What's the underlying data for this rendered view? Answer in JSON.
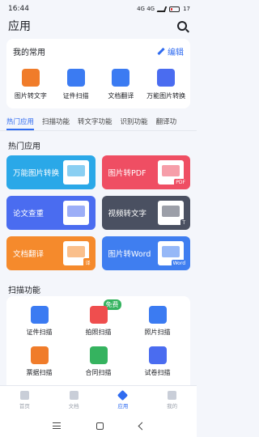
{
  "status_bar": {
    "time": "16:44",
    "network_text": "4G 4G",
    "battery": "17"
  },
  "header": {
    "title": "应用"
  },
  "favorites": {
    "title": "我的常用",
    "edit_label": "编辑",
    "items": [
      {
        "label": "图片转文字",
        "icon": "image-text-icon",
        "color": "#f07c2a"
      },
      {
        "label": "证件扫描",
        "icon": "id-scan-icon",
        "color": "#3b7bf2"
      },
      {
        "label": "文档翻译",
        "icon": "doc-translate-icon",
        "color": "#3b7bf2"
      },
      {
        "label": "万能图片转换",
        "icon": "image-convert-icon",
        "color": "#4a6cf0"
      }
    ]
  },
  "tabs": [
    "热门应用",
    "扫描功能",
    "转文字功能",
    "识别功能",
    "翻译功"
  ],
  "hot_apps": {
    "title": "热门应用",
    "tiles": [
      {
        "label": "万能图片转换",
        "color": "#2aa8e8",
        "tag": "",
        "icon": "image-convert-icon"
      },
      {
        "label": "图片转PDF",
        "color": "#ef4e63",
        "tag": "PDF",
        "icon": "pdf-icon"
      },
      {
        "label": "论文查重",
        "color": "#4a6cf0",
        "tag": "",
        "icon": "magnifier-icon"
      },
      {
        "label": "视频转文字",
        "color": "#4a5061",
        "tag": "T",
        "icon": "video-text-icon"
      },
      {
        "label": "文档翻译",
        "color": "#f58a2c",
        "tag": "译",
        "icon": "translate-icon"
      },
      {
        "label": "图片转Word",
        "color": "#3f7ef0",
        "tag": "Word",
        "icon": "word-icon"
      }
    ]
  },
  "scan": {
    "title": "扫描功能",
    "free_badge": "免费",
    "rows": [
      [
        {
          "label": "证件扫描",
          "color": "#3b7bf2",
          "icon": "id-scan-icon"
        },
        {
          "label": "拍照扫描",
          "color": "#ef4e4e",
          "icon": "camera-scan-icon"
        },
        {
          "label": "照片扫描",
          "color": "#3b7bf2",
          "icon": "photo-scan-icon"
        }
      ],
      [
        {
          "label": "票据扫描",
          "color": "#f07c2a",
          "icon": "receipt-scan-icon"
        },
        {
          "label": "合同扫描",
          "color": "#35b35f",
          "icon": "contract-scan-icon"
        },
        {
          "label": "试卷扫描",
          "color": "#4a6cf0",
          "icon": "exam-scan-icon"
        }
      ]
    ]
  },
  "bottom_nav": [
    {
      "label": "首页",
      "icon": "home-icon"
    },
    {
      "label": "文档",
      "icon": "document-icon"
    },
    {
      "label": "应用",
      "icon": "apps-icon",
      "active": true
    },
    {
      "label": "我的",
      "icon": "profile-icon"
    }
  ]
}
